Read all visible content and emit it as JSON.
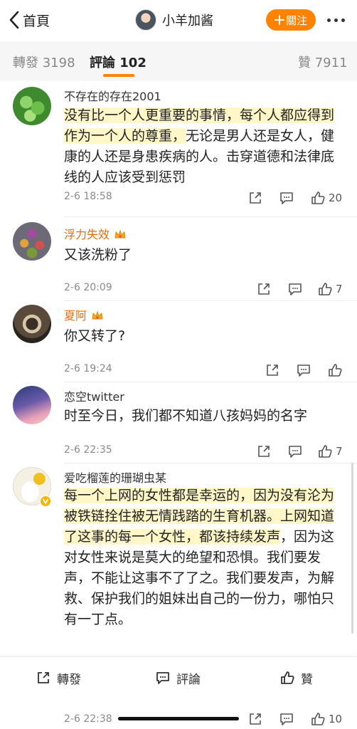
{
  "header": {
    "back_label": "首頁",
    "user_name": "小羊加酱",
    "follow_label": "關注"
  },
  "tabs": [
    {
      "label": "轉發",
      "count": "3198"
    },
    {
      "label": "評論",
      "count": "102"
    },
    {
      "label": "贊",
      "count": "7911"
    }
  ],
  "comments": [
    {
      "name": "不存在的存在2001",
      "text_hl": "没有比一个人更重要的事情，每个人都应得到作为一个人的尊重，",
      "text": "无论是男人还是女人，健康的人还是身患疾病的人。击穿道德和法律底线的人应该受到惩罚",
      "date": "2-6 18:58",
      "likes": "20"
    },
    {
      "name": "浮力失效",
      "text": "又该洗粉了",
      "date": "2-6 20:09",
      "likes": "7"
    },
    {
      "name": "夏阿",
      "text": "你又转了?",
      "date": "2-6 19:24",
      "likes": ""
    },
    {
      "name": "恋空twitter",
      "text": "时至今日，我们都不知道八孩妈妈的名字",
      "date": "2-6 22:35",
      "likes": "7"
    },
    {
      "name": "爱吃榴莲的珊瑚虫某",
      "text_hl": "每一个上网的女性都是幸运的，因为没有沦为被铁链拴住被无情践踏的生育机器。上网知道了这事的每一个女性，都该持续发声",
      "text": "，因为这对女性来说是莫大的绝望和恐惧。我们要发声，不能让这事不了了之。我们要发声，为解救、保护我们的姐妹出自己的一份力，哪怕只有一丁点。",
      "date": "2-6 22:38",
      "likes": "10"
    }
  ],
  "bottom_bar": {
    "repost_label": "轉發",
    "comment_label": "評論",
    "like_label": "贊"
  },
  "colors": {
    "accent": "#ff8200",
    "highlight": "#fff7c8",
    "vip_name": "#e86b0a"
  }
}
